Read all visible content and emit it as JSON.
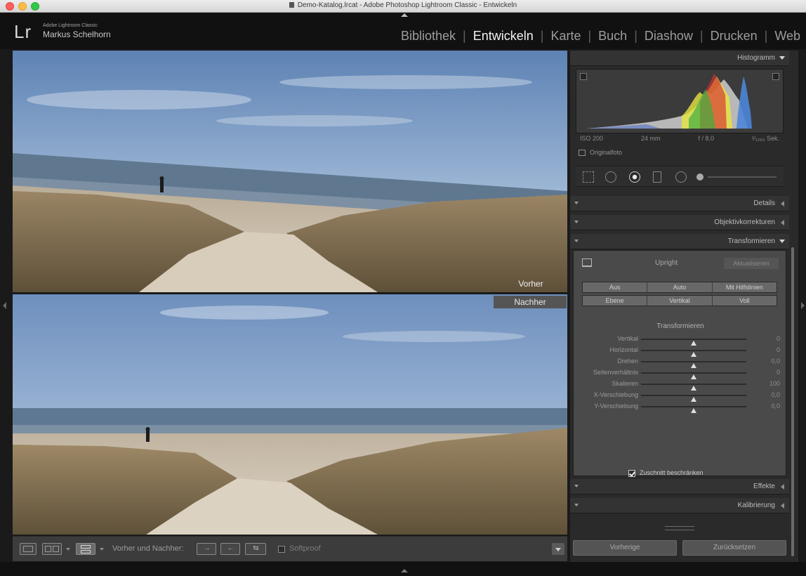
{
  "window": {
    "title": "Demo-Katalog.lrcat - Adobe Photoshop Lightroom Classic - Entwickeln"
  },
  "identity": {
    "logo": "Lr",
    "product": "Adobe Lightroom Classic",
    "user": "Markus Schelhorn"
  },
  "modules": [
    "Bibliothek",
    "Entwickeln",
    "Karte",
    "Buch",
    "Diashow",
    "Drucken",
    "Web"
  ],
  "active_module": "Entwickeln",
  "viewer": {
    "before_label": "Vorher",
    "after_label": "Nachher"
  },
  "toolbar": {
    "before_after_label": "Vorher und Nachher:",
    "copy_before_to_after": "→",
    "copy_after_to_before": "←",
    "swap": "⇆",
    "softproof_label": "Softproof"
  },
  "histogram": {
    "title": "Histogramm",
    "iso": "ISO 200",
    "focal": "24 mm",
    "aperture": "f / 8,0",
    "shutter": "¹⁄₁₂₅₀ Sek.",
    "original_photo_label": "Originalfoto"
  },
  "panels": {
    "details": "Details",
    "lens": "Objektivkorrekturen",
    "transform": "Transformieren",
    "effects": "Effekte",
    "calibration": "Kalibrierung"
  },
  "transform": {
    "upright_label": "Upright",
    "update_button": "Aktualisieren",
    "upright_modes_row1": [
      "Aus",
      "Auto",
      "Mit Hilfslinien"
    ],
    "upright_modes_row2": [
      "Ebene",
      "Vertikal",
      "Voll"
    ],
    "section_title": "Transformieren",
    "sliders": [
      {
        "label": "Vertikal",
        "value": "0",
        "level": 0.5
      },
      {
        "label": "Horizontal",
        "value": "0",
        "level": 0.5
      },
      {
        "label": "Drehen",
        "value": "0,0",
        "level": 0.5
      },
      {
        "label": "Seitenverhältnis",
        "value": "0",
        "level": 0.5
      },
      {
        "label": "Skalieren",
        "value": "100",
        "level": 0.5
      },
      {
        "label": "X-Verschiebung",
        "value": "0,0",
        "level": 0.5
      },
      {
        "label": "Y-Verschiebung",
        "value": "0,0",
        "level": 0.5
      }
    ],
    "constrain_crop_label": "Zuschnitt beschränken"
  },
  "buttons": {
    "previous": "Vorherige",
    "reset": "Zurücksetzen"
  },
  "colors": {
    "active_module": "#f2f2f2",
    "inactive_module": "#9d9d9d",
    "panel_bg": "#2a2a2a",
    "highlight": "#555555"
  }
}
